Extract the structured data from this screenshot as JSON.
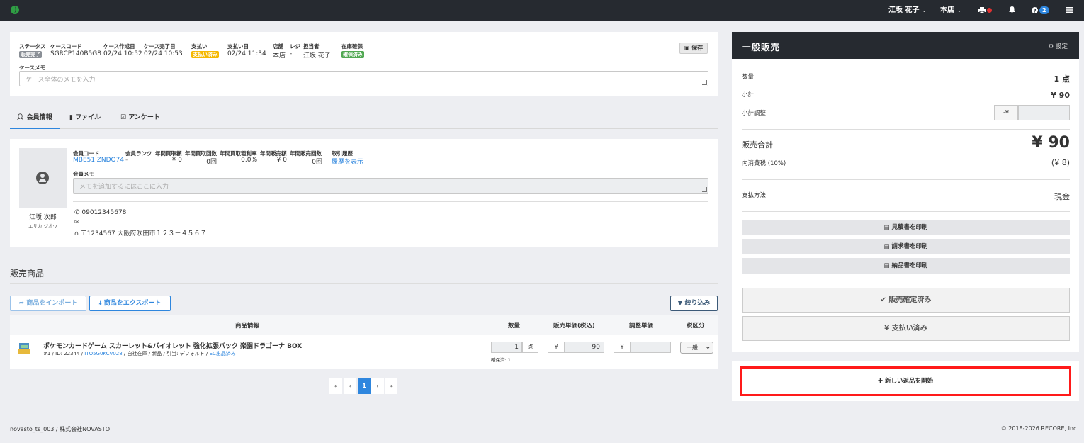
{
  "topbar": {
    "user": "江坂 花子",
    "store": "本店",
    "help_badge": "2",
    "menu_icon": "hamburger-icon",
    "brand_color": "#262a30"
  },
  "case": {
    "labels": {
      "status": "ステータス",
      "code": "ケースコード",
      "created": "ケース作成日",
      "completed": "ケース完了日",
      "payment": "支払い",
      "paid_date": "支払い日",
      "store": "店舗",
      "register": "レジ",
      "staff": "担当者",
      "stock": "在庫確保",
      "memo": "ケースメモ"
    },
    "values": {
      "status": "販売完了",
      "code": "SGRCP140B5G8",
      "created": "02/24 10:52",
      "completed": "02/24 10:53",
      "payment": "支払い済み",
      "paid_date": "02/24 11:34",
      "store": "本店",
      "register": "-",
      "staff": "江坂 花子",
      "stock": "確保済み"
    },
    "memo_placeholder": "ケース全体のメモを入力",
    "save_label": "保存"
  },
  "tabs": [
    {
      "label": "会員情報",
      "icon": "user-icon"
    },
    {
      "label": "ファイル",
      "icon": "file-icon"
    },
    {
      "label": "アンケート",
      "icon": "checkbox-icon"
    }
  ],
  "member": {
    "labels": {
      "code": "会員コード",
      "rank": "会員ランク",
      "annual_buy_amount": "年間買取額",
      "annual_buy_count": "年間買取回数",
      "annual_buy_margin": "年間買取粗利率",
      "annual_sale_amount": "年間販売額",
      "annual_sale_count": "年間販売回数",
      "history": "取引履歴",
      "memo": "会員メモ"
    },
    "values": {
      "code": "MBE51IZNDQ74",
      "rank": "-",
      "annual_buy_amount": "¥ 0",
      "annual_buy_count": "0回",
      "annual_buy_margin": "0.0%",
      "annual_sale_amount": "¥ 0",
      "annual_sale_count": "0回",
      "history": "履歴を表示"
    },
    "memo_placeholder": "メモを追加するにはここに入力",
    "name": "江坂 次郎",
    "kana": "エサカ ジオウ",
    "phone": "09012345678",
    "email": "",
    "address": "〒1234567 大阪府吹田市１２３－４５６７"
  },
  "sales": {
    "title": "販売商品",
    "import_label": "商品をインポート",
    "export_label": "商品をエクスポート",
    "filter_label": "絞り込み",
    "columns": [
      "商品情報",
      "数量",
      "販売単価(税込)",
      "調整単価",
      "税区分"
    ],
    "items": [
      {
        "name": "ポケモンカードゲーム スカーレット&バイオレット 強化拡張パック 楽園ドラゴーナ BOX",
        "meta_prefix": "#1 / ID: 22344 / ",
        "meta_code": "ITO5G0KCV028",
        "meta_mid": " / 自社在庫 / 新品 / 引当: デフォルト / ",
        "meta_ec": "EC出品済み",
        "qty": "1",
        "qty_unit": "点",
        "reserved": "確保済: 1",
        "price_prefix": "¥",
        "price": "90",
        "adj_prefix": "¥",
        "adj_price": "",
        "tax": "一般"
      }
    ],
    "pagination": [
      "«",
      "‹",
      "1",
      "›",
      "»"
    ],
    "current_page": "1"
  },
  "side": {
    "title": "一般販売",
    "settings_label": "設定",
    "qty_label": "数量",
    "qty_value": "1 点",
    "subtotal_label": "小計",
    "subtotal_value": "¥ 90",
    "adjust_label": "小計調整",
    "adjust_prefix": "-¥",
    "total_label": "販売合計",
    "total_value": "¥ 90",
    "tax_label": "内消費税 (10%)",
    "tax_value": "(¥ 8)",
    "payment_label": "支払方法",
    "payment_value": "現金",
    "print_estimate": "見積書を印刷",
    "print_invoice": "請求書を印刷",
    "print_delivery": "納品書を印刷",
    "confirmed_label": "販売確定済み",
    "paid_label": "¥ 支払い済み",
    "new_return_label": "新しい返品を開始"
  },
  "footer": {
    "left": "novasto_ts_003 / 株式会社NOVASTO",
    "right": "© 2018-2026 RECORE, Inc."
  }
}
